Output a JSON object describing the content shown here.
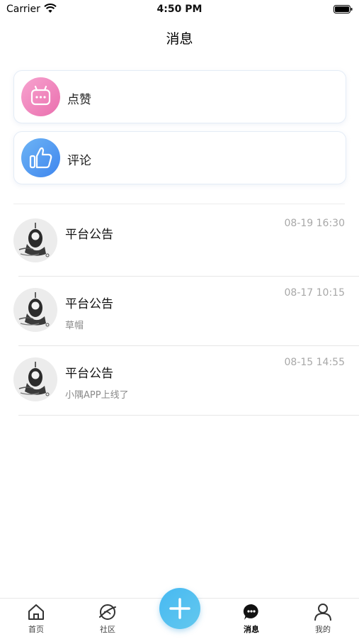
{
  "status_bar": {
    "carrier": "Carrier",
    "time": "4:50 PM"
  },
  "header": {
    "title": "消息"
  },
  "categories": [
    {
      "label": "点赞",
      "icon": "chat-bubble-icon",
      "color": "#ef7fb8"
    },
    {
      "label": "评论",
      "icon": "thumbs-up-icon",
      "color": "#4a90ef"
    }
  ],
  "messages": [
    {
      "title": "平台公告",
      "time": "08-19 16:30",
      "preview": ""
    },
    {
      "title": "平台公告",
      "time": "08-17 10:15",
      "preview": "草帽"
    },
    {
      "title": "平台公告",
      "time": "08-15 14:55",
      "preview": "小隅APP上线了"
    }
  ],
  "tab_bar": {
    "tabs": [
      {
        "label": "首页",
        "icon": "home-icon"
      },
      {
        "label": "社区",
        "icon": "planet-icon"
      },
      {
        "label": "消息",
        "icon": "message-icon",
        "active": true
      },
      {
        "label": "我的",
        "icon": "user-icon"
      }
    ],
    "center_button": {
      "icon": "plus-icon",
      "color": "#4dbcf0"
    }
  }
}
